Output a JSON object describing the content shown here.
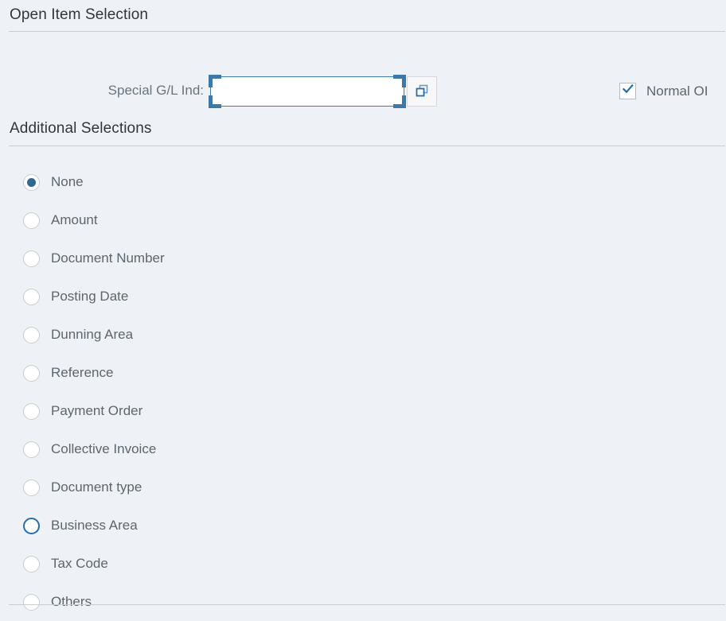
{
  "open_item_selection": {
    "title": "Open Item Selection",
    "field": {
      "label": "Special G/L Ind:",
      "value": "",
      "placeholder": "",
      "value_help_icon": "overlapping-squares-icon"
    },
    "checkbox": {
      "label": "Normal OI",
      "checked": true,
      "icon": "checkmark-icon"
    }
  },
  "additional_selections": {
    "title": "Additional Selections",
    "options": [
      {
        "label": "None",
        "state": "selected"
      },
      {
        "label": "Amount",
        "state": "default"
      },
      {
        "label": "Document Number",
        "state": "default"
      },
      {
        "label": "Posting Date",
        "state": "default"
      },
      {
        "label": "Dunning Area",
        "state": "default"
      },
      {
        "label": "Reference",
        "state": "default"
      },
      {
        "label": "Payment Order",
        "state": "default"
      },
      {
        "label": "Collective Invoice",
        "state": "default"
      },
      {
        "label": "Document type",
        "state": "default"
      },
      {
        "label": "Business Area",
        "state": "focused"
      },
      {
        "label": "Tax Code",
        "state": "default"
      },
      {
        "label": "Others",
        "state": "default"
      }
    ]
  },
  "colors": {
    "background": "#eef2f6",
    "accent": "#31688e",
    "focus_border": "#3c78a8",
    "label_text": "#5c6670",
    "title_text": "#32363a",
    "rule": "#c6cdd4"
  }
}
